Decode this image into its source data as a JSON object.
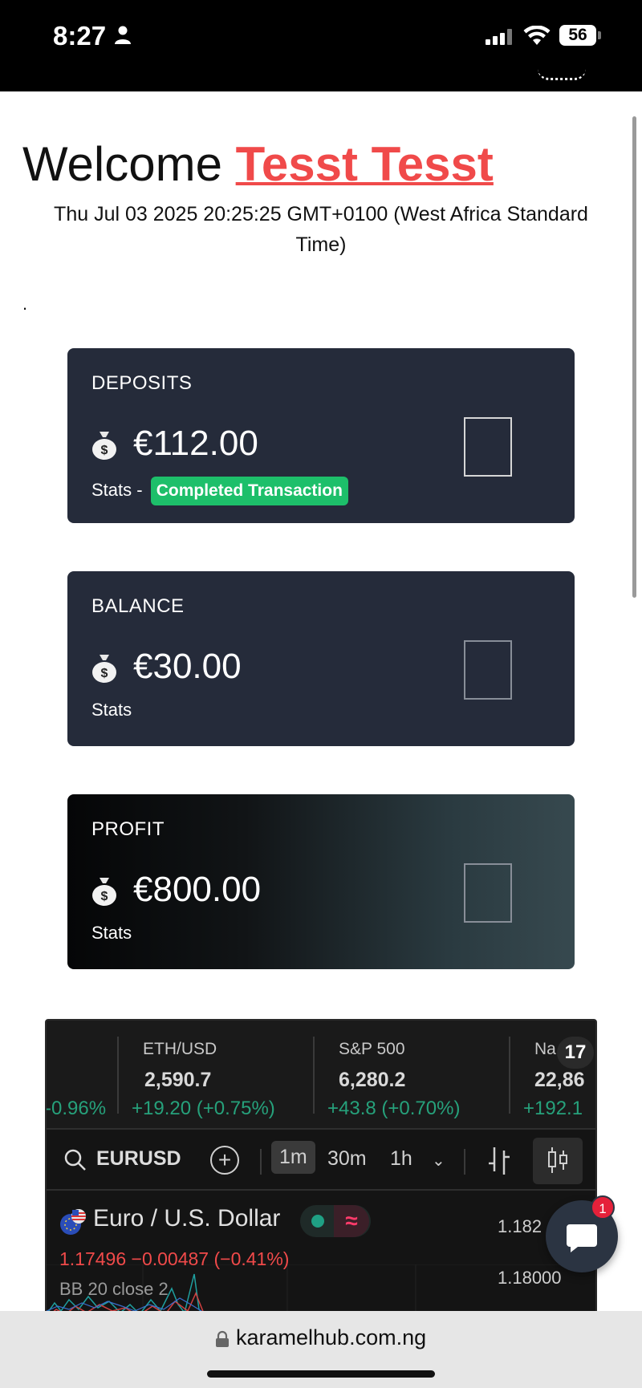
{
  "status_bar": {
    "time": "8:27",
    "battery": "56"
  },
  "header": {
    "welcome_prefix": "Welcome",
    "user_name": "Tesst Tesst",
    "datetime": "Thu Jul 03 2025 20:25:25 GMT+0100 (West Africa Standard Time)",
    "dot": "."
  },
  "cards": [
    {
      "title": "DEPOSITS",
      "amount": "€112.00",
      "stats_label": "Stats -",
      "badge": "Completed Transaction"
    },
    {
      "title": "BALANCE",
      "amount": "€30.00",
      "stats_label": "Stats"
    },
    {
      "title": "PROFIT",
      "amount": "€800.00",
      "stats_label": "Stats"
    }
  ],
  "ticker": [
    {
      "name": "",
      "price": "",
      "change": "-0.96%"
    },
    {
      "name": "ETH/USD",
      "price": "2,590.7",
      "change": "+19.20 (+0.75%)"
    },
    {
      "name": "S&P 500",
      "price": "6,280.2",
      "change": "+43.8 (+0.70%)"
    },
    {
      "name": "Na",
      "price": "22,86",
      "change": "+192.1"
    }
  ],
  "tv_logo": "17",
  "toolbar": {
    "symbol": "EURUSD",
    "plus": "+",
    "intervals": [
      "1m",
      "30m",
      "1h"
    ],
    "active_interval": "1m",
    "chevron": "⌄"
  },
  "chart": {
    "title": "Euro / U.S. Dollar",
    "quote": "1.17496  −0.00487 (−0.41%)",
    "indicator": "BB 20 close 2",
    "y_labels": [
      "1.182",
      "1.18000"
    ],
    "wave": "≈"
  },
  "chat": {
    "badge": "1"
  },
  "address_bar": {
    "url": "karamelhub.com.ng"
  },
  "colors": {
    "accent_name": "#f04a4a",
    "card_bg": "#252b3a",
    "badge_green": "#1dbf6a",
    "ticker_green": "#26a17b",
    "quote_red": "#f04a4a"
  }
}
